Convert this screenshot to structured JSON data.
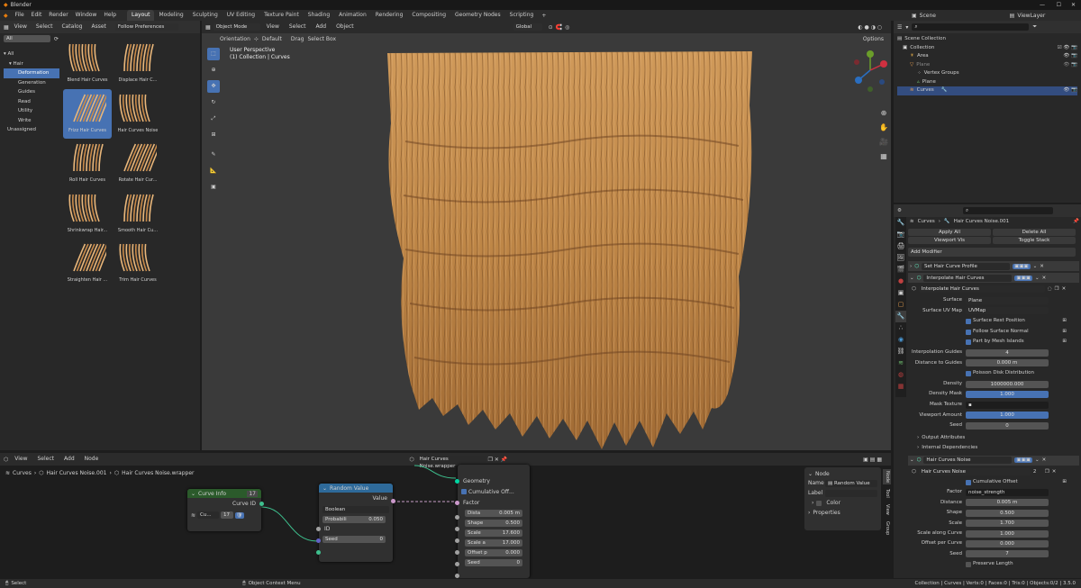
{
  "titlebar": {
    "title": "Blender"
  },
  "menubar": {
    "items": [
      "File",
      "Edit",
      "Render",
      "Window",
      "Help"
    ]
  },
  "workspaces": [
    "Layout",
    "Modeling",
    "Sculpting",
    "UV Editing",
    "Texture Paint",
    "Shading",
    "Animation",
    "Rendering",
    "Compositing",
    "Geometry Nodes",
    "Scripting"
  ],
  "scene": {
    "label": "Scene",
    "viewlayer": "ViewLayer"
  },
  "asset_browser": {
    "menus": [
      "View",
      "Select",
      "Catalog",
      "Asset"
    ],
    "library": "Follow Preferences",
    "filter": "All",
    "tree": [
      "All",
      "Hair",
      "Deformation",
      "Generation",
      "Guides",
      "Read",
      "Utility",
      "Write",
      "Unassigned"
    ],
    "assets": [
      "Blend Hair Curves",
      "Displace Hair C...",
      "Frizz Hair Curves",
      "Hair Curves Noise",
      "Roll Hair Curves",
      "Rotate Hair Cur...",
      "Shrinkwrap Hair...",
      "Smooth Hair Cu...",
      "Straighten Hair ...",
      "Trim Hair Curves"
    ]
  },
  "viewport": {
    "mode": "Object Mode",
    "menus": [
      "View",
      "Select",
      "Add",
      "Object"
    ],
    "transform": "Global",
    "orientation_label": "Orientation",
    "orientation": "Default",
    "drag_label": "Drag",
    "drag": "Select Box",
    "options": "Options",
    "overlay_title": "User Perspective",
    "overlay_sub": "(1) Collection | Curves"
  },
  "outliner": {
    "root": "Scene Collection",
    "collection": "Collection",
    "items": [
      "Area",
      "Plane",
      "Vertex Groups",
      "Plane",
      "Curves"
    ]
  },
  "properties": {
    "breadcrumb_object": "Curves",
    "breadcrumb_mod": "Hair Curves Noise.001",
    "apply_all": "Apply All",
    "delete_all": "Delete All",
    "viewport_vis": "Viewport Vis",
    "toggle_stack": "Toggle Stack",
    "add_modifier": "Add Modifier",
    "mod1": "Set Hair Curve Profile",
    "mod2": "Interpolate Hair Curves",
    "mod2_node": "Interpolate Hair Curves",
    "surface_label": "Surface",
    "surface": "Plane",
    "uvmap_label": "Surface UV Map",
    "uvmap": "UVMap",
    "checks1": [
      "Surface Rest Position",
      "Follow Surface Normal",
      "Part by Mesh Islands"
    ],
    "interp_guides_label": "Interpolation Guides",
    "interp_guides": "4",
    "dist_guides_label": "Distance to Guides",
    "dist_guides": "0.000 m",
    "poisson": "Poisson Disk Distribution",
    "density_label": "Density",
    "density": "1000000.000",
    "density_mask_label": "Density Mask",
    "density_mask": "1.000",
    "mask_tex_label": "Mask Texture",
    "vp_amount_label": "Viewport Amount",
    "vp_amount": "1.000",
    "seed_label": "Seed",
    "seed": "0",
    "output_attrs": "Output Attributes",
    "internal_deps": "Internal Dependencies",
    "mod3": "Hair Curves Noise",
    "mod3_node": "Hair Curves Noise",
    "mod3_users": "2",
    "cum_offset": "Cumulative Offset",
    "factor_label": "Factor",
    "factor": "noise_strength",
    "distance_label": "Distance",
    "distance": "0.005 m",
    "shape_label": "Shape",
    "shape": "0.500",
    "scale_label": "Scale",
    "scale": "1.700",
    "scale_curve_label": "Scale along Curve",
    "scale_curve": "1.000",
    "offset_curve_label": "Offset per Curve",
    "offset_curve": "0.000",
    "seed2_label": "Seed",
    "seed2": "7",
    "preserve_len": "Preserve Length"
  },
  "node_editor": {
    "menus": [
      "View",
      "Select",
      "Add",
      "Node"
    ],
    "tree_name": "Hair Curves Noise.wrapper",
    "breadcrumb": [
      "Curves",
      "Hair Curves Noise.001",
      "Hair Curves Noise.wrapper"
    ],
    "curve_info": {
      "title": "Curve Info",
      "users": "17",
      "output": "Curve ID",
      "field": "Cu...",
      "num": "17"
    },
    "random": {
      "title": "Random Value",
      "output": "Value",
      "type": "Boolean",
      "prob_label": "Probabili",
      "prob": "0.050",
      "id": "ID",
      "seed_label": "Seed",
      "seed": "0"
    },
    "group": {
      "geometry": "Geometry",
      "cum": "Cumulative Off...",
      "factor": "Factor",
      "fields": [
        [
          "Dista",
          "0.005 m"
        ],
        [
          "Shape",
          "0.500"
        ],
        [
          "Scale",
          "17.600"
        ],
        [
          "Scale a",
          "17.000"
        ],
        [
          "Offset p",
          "0.000"
        ],
        [
          "Seed",
          "0"
        ]
      ]
    },
    "side": {
      "title": "Node",
      "name_label": "Name",
      "name": "Random Value",
      "label_label": "Label",
      "color": "Color",
      "props": "Properties",
      "tabs": [
        "Node",
        "Tool",
        "View",
        "Group"
      ]
    }
  },
  "statusbar": {
    "left": "Select",
    "mid": "Object Context Menu",
    "right": "Collection | Curves | Verts:0 | Faces:0 | Tris:0 | Objects:0/2 | 3.5.0"
  }
}
